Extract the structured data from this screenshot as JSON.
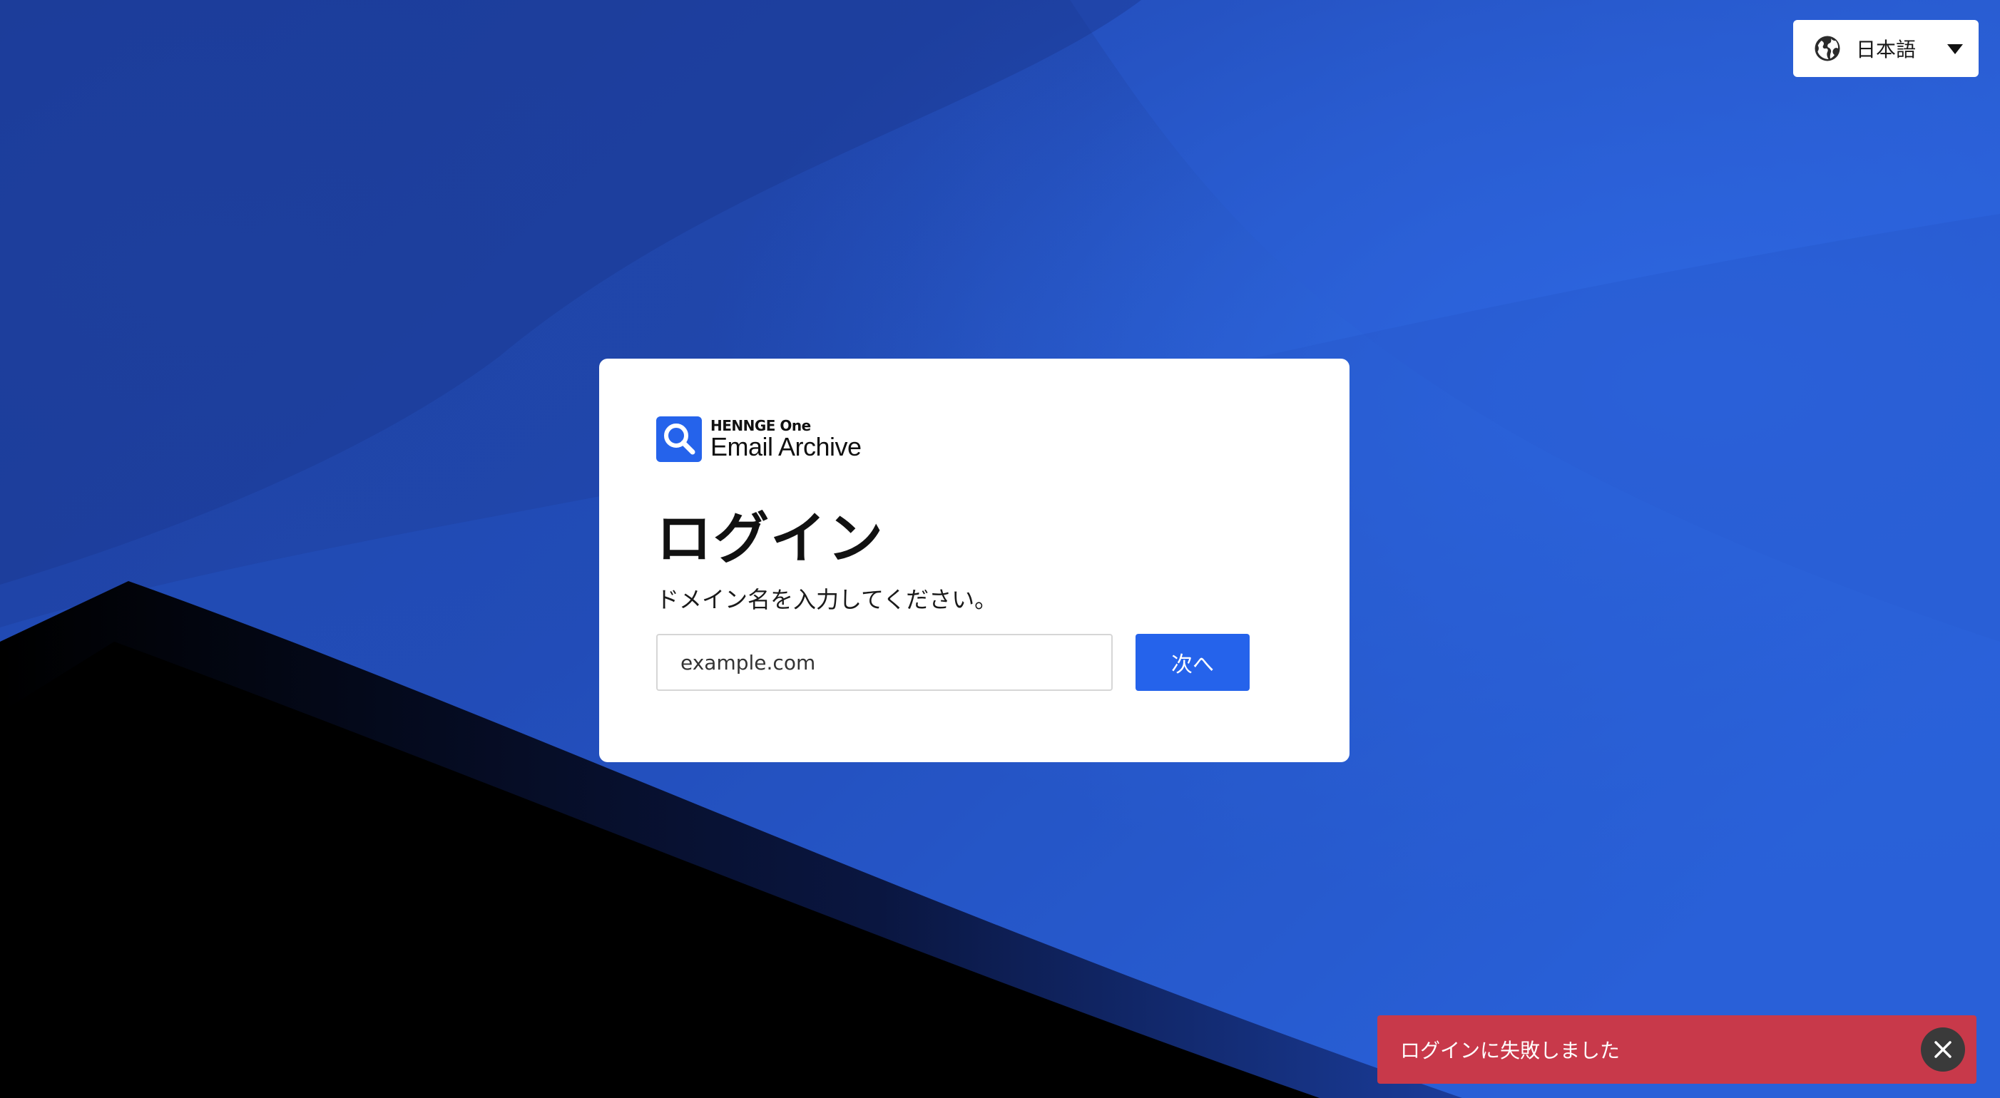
{
  "language_selector": {
    "label": "日本語",
    "icons": {
      "globe": "globe-icon",
      "caret": "caret-down-icon"
    }
  },
  "login": {
    "logo": {
      "brand": "HENNGE One",
      "product": "Email Archive",
      "icon": "magnifier-icon"
    },
    "title": "ログイン",
    "instruction": "ドメイン名を入力してください。",
    "domain_input": {
      "value": "",
      "placeholder": "example.com"
    },
    "next_label": "次へ"
  },
  "toast": {
    "message": "ログインに失敗しました",
    "close_icon": "close-icon",
    "color": "#c8394a"
  },
  "colors": {
    "accent": "#2563eb",
    "background": "#1f49b3",
    "error": "#c8394a"
  }
}
